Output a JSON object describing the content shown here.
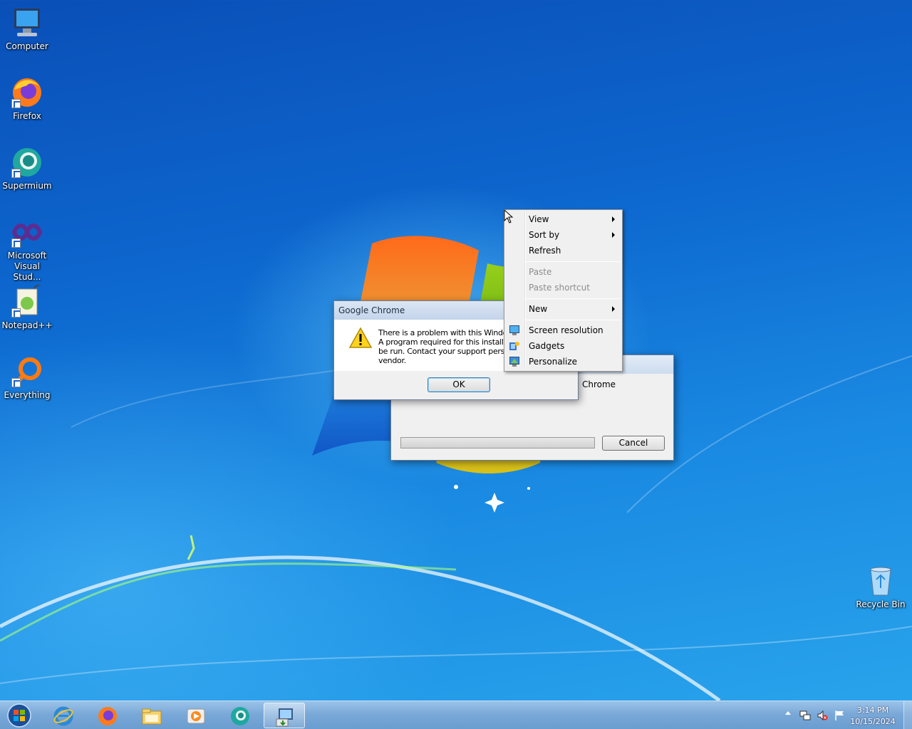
{
  "desktop_icons": [
    {
      "label": "Computer",
      "icon": "computer-icon"
    },
    {
      "label": "Firefox",
      "icon": "firefox-icon"
    },
    {
      "label": "Supermium",
      "icon": "supermium-icon"
    },
    {
      "label": "Microsoft Visual Stud...",
      "icon": "visual-studio-icon"
    },
    {
      "label": "Notepad++",
      "icon": "notepad-plus-plus-icon"
    },
    {
      "label": "Everything",
      "icon": "everything-icon"
    },
    {
      "label": "Recycle Bin",
      "icon": "recycle-bin-icon"
    }
  ],
  "installer_window": {
    "partial_text": "Chrome",
    "progress": 0,
    "cancel_label": "Cancel"
  },
  "error_dialog": {
    "title": "Google Chrome",
    "message_lines": [
      "There is a problem with this Windows",
      "A program required for this install to cc",
      "be run. Contact your support personn",
      "vendor."
    ],
    "ok_label": "OK",
    "icon": "warning-icon"
  },
  "context_menu": {
    "view": "View",
    "sort_by": "Sort by",
    "refresh": "Refresh",
    "paste": "Paste",
    "paste_shortcut": "Paste shortcut",
    "new": "New",
    "screen_resolution": "Screen resolution",
    "gadgets": "Gadgets",
    "personalize": "Personalize"
  },
  "taskbar": {
    "pinned": [
      "start-orb-icon",
      "internet-explorer-icon",
      "firefox-icon",
      "file-explorer-icon",
      "media-player-icon",
      "supermium-icon",
      "installer-icon"
    ],
    "clock": {
      "time": "3:14 PM",
      "date": "10/15/2024"
    }
  }
}
